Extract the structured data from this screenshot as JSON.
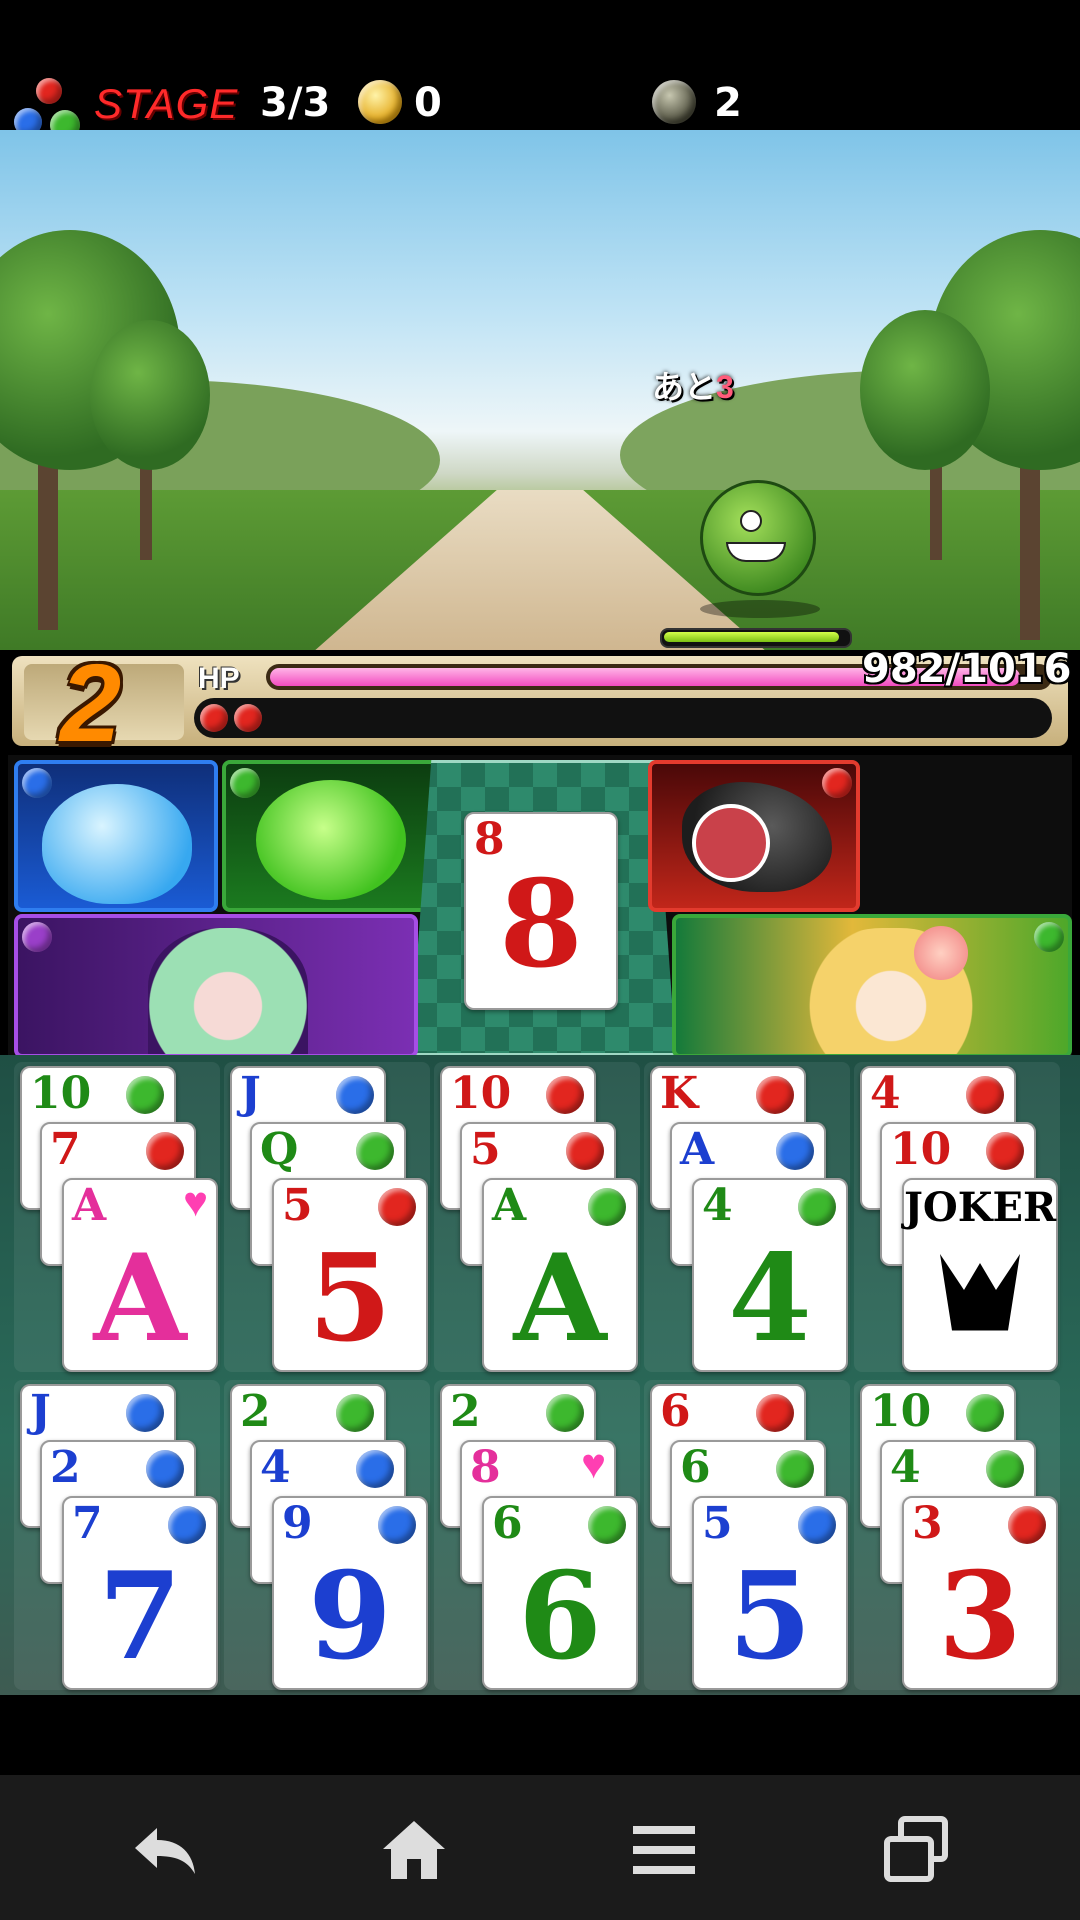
{
  "hud": {
    "stage_label": "STAGE",
    "stage_value": "3/3",
    "coins": "0",
    "items": "2"
  },
  "battle": {
    "turns_left_prefix": "あと",
    "turns_left_value": "3",
    "enemy_hp_fraction": 0.97
  },
  "status": {
    "combo": "2",
    "hp_label": "HP",
    "hp_value": "982/1016",
    "hp_current": 982,
    "hp_max": 1016,
    "queued_orbs": [
      "red",
      "red"
    ]
  },
  "center_card": {
    "rank": "8",
    "suit": "red"
  },
  "tableau": {
    "top_row": [
      [
        {
          "rank": "10",
          "suit": "green"
        },
        {
          "rank": "7",
          "suit": "red"
        },
        {
          "rank": "A",
          "suit": "heart"
        }
      ],
      [
        {
          "rank": "J",
          "suit": "blue"
        },
        {
          "rank": "Q",
          "suit": "green"
        },
        {
          "rank": "5",
          "suit": "red"
        }
      ],
      [
        {
          "rank": "10",
          "suit": "red"
        },
        {
          "rank": "5",
          "suit": "red"
        },
        {
          "rank": "A",
          "suit": "green"
        }
      ],
      [
        {
          "rank": "K",
          "suit": "red"
        },
        {
          "rank": "A",
          "suit": "blue"
        },
        {
          "rank": "4",
          "suit": "green"
        }
      ],
      [
        {
          "rank": "4",
          "suit": "red"
        },
        {
          "rank": "10",
          "suit": "red"
        },
        {
          "rank": "JOKER",
          "suit": "joker"
        }
      ]
    ],
    "bottom_row": [
      [
        {
          "rank": "J",
          "suit": "blue"
        },
        {
          "rank": "2",
          "suit": "blue"
        },
        {
          "rank": "7",
          "suit": "blue"
        }
      ],
      [
        {
          "rank": "2",
          "suit": "green"
        },
        {
          "rank": "4",
          "suit": "blue"
        },
        {
          "rank": "9",
          "suit": "blue"
        }
      ],
      [
        {
          "rank": "2",
          "suit": "green"
        },
        {
          "rank": "8",
          "suit": "heart"
        },
        {
          "rank": "6",
          "suit": "green"
        }
      ],
      [
        {
          "rank": "6",
          "suit": "red"
        },
        {
          "rank": "6",
          "suit": "green"
        },
        {
          "rank": "5",
          "suit": "blue"
        }
      ],
      [
        {
          "rank": "10",
          "suit": "green"
        },
        {
          "rank": "4",
          "suit": "green"
        },
        {
          "rank": "3",
          "suit": "red"
        }
      ]
    ]
  },
  "colors": {
    "red": "#d01818",
    "blue": "#1c3fd0",
    "green": "#1f8a16",
    "heart": "#e42f9b",
    "hp_pink": "#f24bbf"
  },
  "nav": {
    "icons": [
      "back-icon",
      "home-icon",
      "menu-icon",
      "recent-apps-icon"
    ]
  }
}
